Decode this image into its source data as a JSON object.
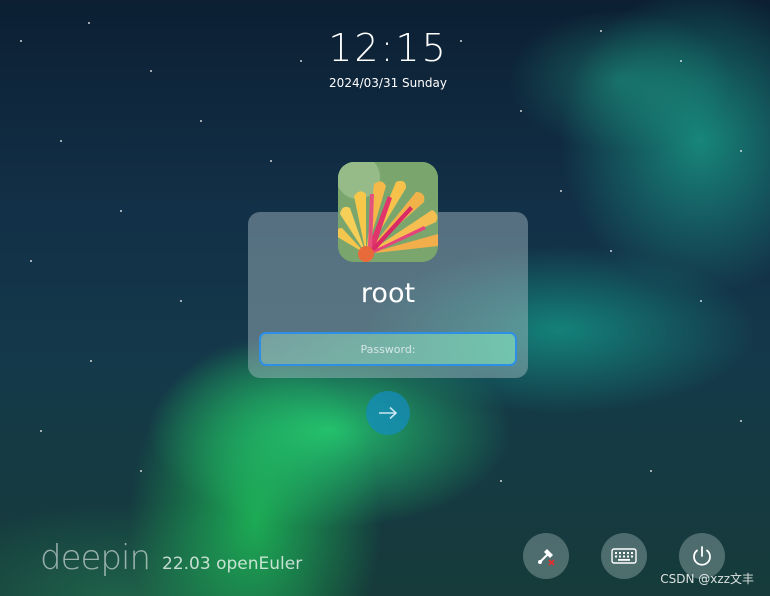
{
  "clock": {
    "time": "12:15",
    "date": "2024/03/31 Sunday"
  },
  "user": {
    "name": "root",
    "avatar_icon": "daisy-flower-avatar"
  },
  "password": {
    "placeholder": "Password:",
    "value": ""
  },
  "submit": {
    "icon": "arrow-right-icon"
  },
  "brand": {
    "logo_text": "deepin",
    "version": "22.03 openEuler"
  },
  "controls": [
    {
      "name": "network-disconnected-icon"
    },
    {
      "name": "keyboard-icon"
    },
    {
      "name": "power-icon"
    }
  ],
  "watermark": {
    "text": "CSDN @xzz文丰"
  },
  "colors": {
    "accent": "#2e8fe6",
    "submit": "#148cbe"
  }
}
